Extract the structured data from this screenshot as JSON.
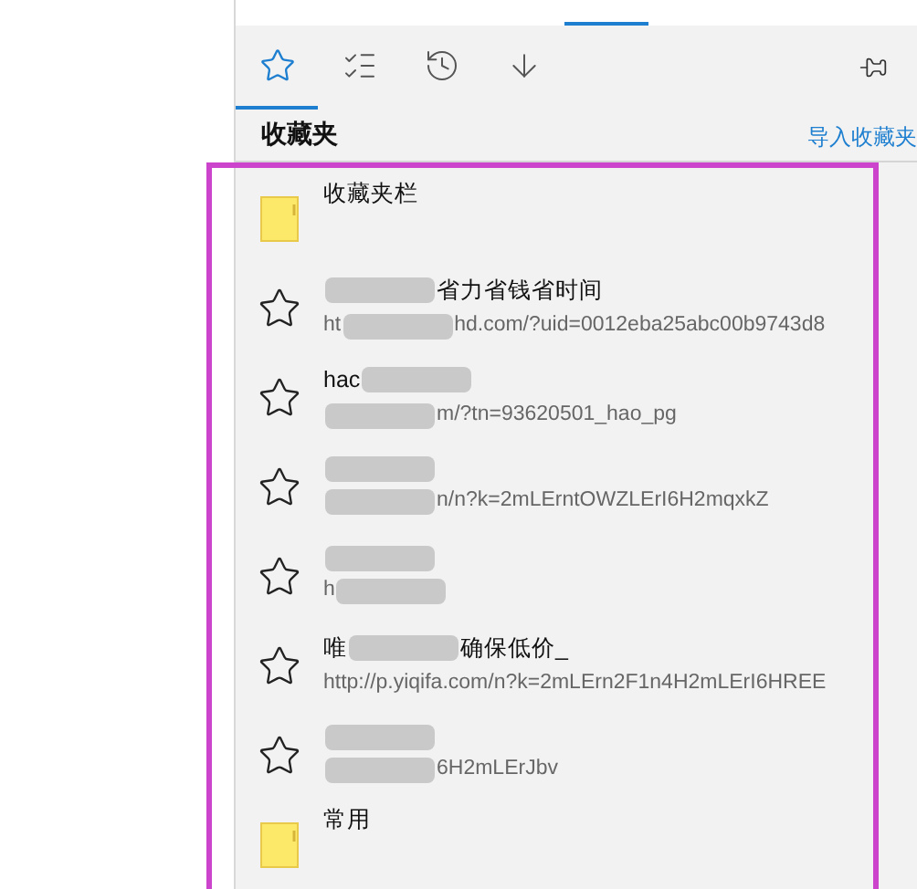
{
  "tabs": [
    {
      "kind": "favorites",
      "selected": true
    },
    {
      "kind": "reading-list",
      "selected": false
    },
    {
      "kind": "history",
      "selected": false
    },
    {
      "kind": "downloads",
      "selected": false
    }
  ],
  "header": {
    "title": "收藏夹",
    "link": "导入收藏夹"
  },
  "items": [
    {
      "kind": "folder",
      "title": [
        {
          "kind": "text",
          "text": "收藏夹栏"
        }
      ]
    },
    {
      "kind": "bookmark",
      "title": [
        {
          "kind": "redaction"
        },
        {
          "kind": "text",
          "text": "省力省钱省时间"
        }
      ],
      "url": [
        {
          "kind": "text",
          "text": "ht"
        },
        {
          "kind": "redaction"
        },
        {
          "kind": "text",
          "text": "hd.com/?uid=0012eba25abc00b9743d8"
        }
      ]
    },
    {
      "kind": "bookmark",
      "title": [
        {
          "kind": "text",
          "text": "hac"
        },
        {
          "kind": "redaction"
        }
      ],
      "url": [
        {
          "kind": "redaction"
        },
        {
          "kind": "text",
          "text": "m/?tn=93620501_hao_pg"
        }
      ]
    },
    {
      "kind": "bookmark",
      "title": [
        {
          "kind": "redaction"
        }
      ],
      "url": [
        {
          "kind": "redaction"
        },
        {
          "kind": "text",
          "text": "n/n?k=2mLErntOWZLErI6H2mqxkZ"
        }
      ]
    },
    {
      "kind": "bookmark",
      "title": [
        {
          "kind": "redaction"
        }
      ],
      "url": [
        {
          "kind": "text",
          "text": "h"
        },
        {
          "kind": "redaction"
        }
      ]
    },
    {
      "kind": "bookmark",
      "title": [
        {
          "kind": "text",
          "text": "唯"
        },
        {
          "kind": "redaction"
        },
        {
          "kind": "text",
          "text": "确保低价_"
        }
      ],
      "url": [
        {
          "kind": "text",
          "text": "http://p.yiqifa.com/n?k=2mLErn2F1n4H2mLErI6HREE"
        }
      ]
    },
    {
      "kind": "bookmark",
      "title": [
        {
          "kind": "redaction"
        }
      ],
      "url": [
        {
          "kind": "redaction"
        },
        {
          "kind": "text",
          "text": "6H2mLErJbv"
        }
      ]
    },
    {
      "kind": "folder",
      "title": [
        {
          "kind": "text",
          "text": "常用"
        }
      ]
    }
  ]
}
